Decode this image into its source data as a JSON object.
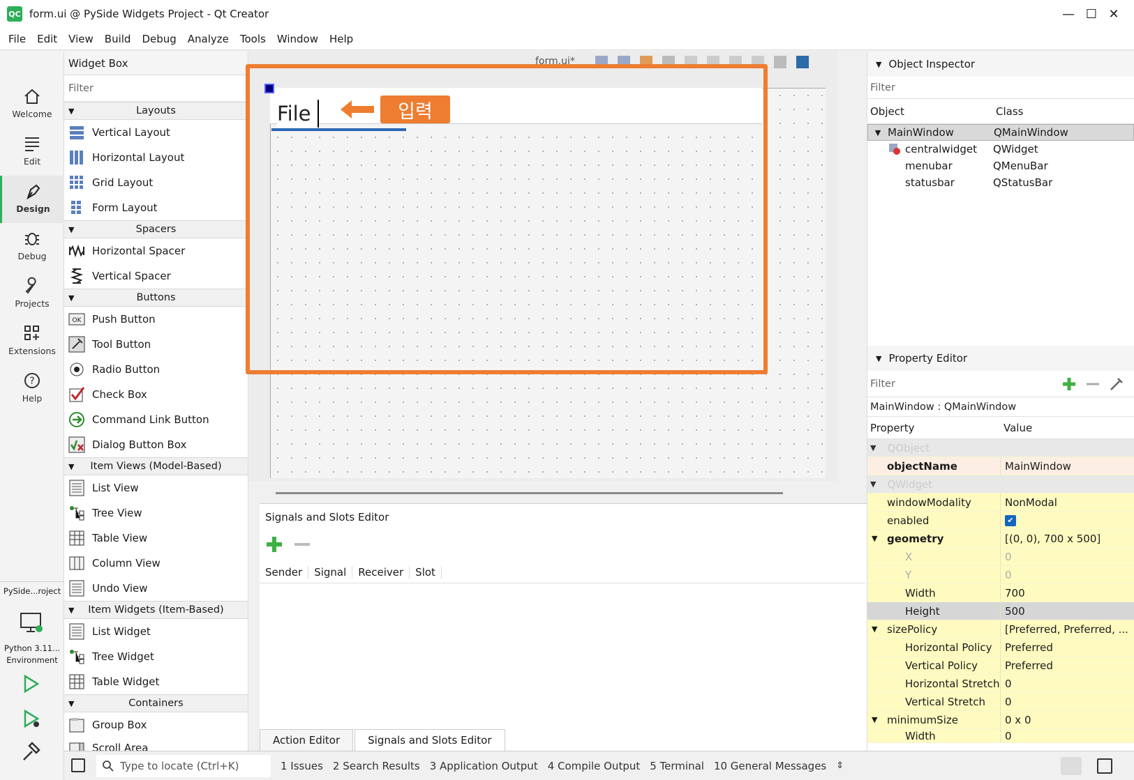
{
  "window": {
    "logo": "QC",
    "title": "form.ui @ PySide Widgets Project - Qt Creator",
    "minimize": "—",
    "maximize": "☐",
    "close": "✕"
  },
  "menubar": [
    "File",
    "Edit",
    "View",
    "Build",
    "Debug",
    "Analyze",
    "Tools",
    "Window",
    "Help"
  ],
  "modes": [
    {
      "label": "Welcome",
      "icon": "home-icon"
    },
    {
      "label": "Edit",
      "icon": "document-lines-icon"
    },
    {
      "label": "Design",
      "icon": "pen-icon"
    },
    {
      "label": "Debug",
      "icon": "bug-icon"
    },
    {
      "label": "Projects",
      "icon": "wrench-icon"
    },
    {
      "label": "Extensions",
      "icon": "grid-plus-icon"
    },
    {
      "label": "Help",
      "icon": "question-icon"
    }
  ],
  "kit": {
    "project": "PySide...roject",
    "env_line1": "Python 3.11...",
    "env_line2": "Environment"
  },
  "widget_box": {
    "title": "Widget Box",
    "filter_placeholder": "Filter",
    "categories": [
      {
        "label": "Layouts",
        "items": [
          "Vertical Layout",
          "Horizontal Layout",
          "Grid Layout",
          "Form Layout"
        ]
      },
      {
        "label": "Spacers",
        "items": [
          "Horizontal Spacer",
          "Vertical Spacer"
        ]
      },
      {
        "label": "Buttons",
        "items": [
          "Push Button",
          "Tool Button",
          "Radio Button",
          "Check Box",
          "Command Link Button",
          "Dialog Button Box"
        ]
      },
      {
        "label": "Item Views (Model-Based)",
        "items": [
          "List View",
          "Tree View",
          "Table View",
          "Column View",
          "Undo View"
        ]
      },
      {
        "label": "Item Widgets (Item-Based)",
        "items": [
          "List Widget",
          "Tree Widget",
          "Table Widget"
        ]
      },
      {
        "label": "Containers",
        "items": [
          "Group Box",
          "Scroll Area"
        ]
      }
    ]
  },
  "form": {
    "tab_label": "form.ui*",
    "menu_input_value": "File",
    "callout_label": "입력"
  },
  "signals_editor": {
    "title": "Signals and Slots Editor",
    "columns": [
      "Sender",
      "Signal",
      "Receiver",
      "Slot"
    ],
    "tabs": [
      "Action Editor",
      "Signals and Slots Editor"
    ]
  },
  "object_inspector": {
    "title": "Object Inspector",
    "filter_placeholder": "Filter",
    "col_object": "Object",
    "col_class": "Class",
    "rows": [
      {
        "object": "MainWindow",
        "class": "QMainWindow"
      },
      {
        "object": "centralwidget",
        "class": "QWidget"
      },
      {
        "object": "menubar",
        "class": "QMenuBar"
      },
      {
        "object": "statusbar",
        "class": "QStatusBar"
      }
    ]
  },
  "property_editor": {
    "title": "Property Editor",
    "filter_placeholder": "Filter",
    "context": "MainWindow : QMainWindow",
    "col_property": "Property",
    "col_value": "Value",
    "group_qobject": "QObject",
    "group_qwidget": "QWidget",
    "props": {
      "objectName": {
        "name": "objectName",
        "value": "MainWindow"
      },
      "windowModality": {
        "name": "windowModality",
        "value": "NonModal"
      },
      "enabled": {
        "name": "enabled",
        "value": "✔"
      },
      "geometry": {
        "name": "geometry",
        "value": "[(0, 0), 700 x 500]"
      },
      "x": {
        "name": "X",
        "value": "0"
      },
      "y": {
        "name": "Y",
        "value": "0"
      },
      "width": {
        "name": "Width",
        "value": "700"
      },
      "height": {
        "name": "Height",
        "value": "500"
      },
      "sizePolicy": {
        "name": "sizePolicy",
        "value": "[Preferred, Preferred, ..."
      },
      "hpolicy": {
        "name": "Horizontal Policy",
        "value": "Preferred"
      },
      "vpolicy": {
        "name": "Vertical Policy",
        "value": "Preferred"
      },
      "hstretch": {
        "name": "Horizontal Stretch",
        "value": "0"
      },
      "vstretch": {
        "name": "Vertical Stretch",
        "value": "0"
      },
      "minimumSize": {
        "name": "minimumSize",
        "value": "0 x 0"
      },
      "minwidth": {
        "name": "Width",
        "value": "0"
      }
    }
  },
  "statusbar": {
    "locator_placeholder": "Type to locate (Ctrl+K)",
    "panes": [
      "1  Issues",
      "2  Search Results",
      "3  Application Output",
      "4  Compile Output",
      "5  Terminal",
      "10  General Messages"
    ]
  },
  "colors": {
    "accent": "#ee7d31",
    "qt_green": "#2eae59",
    "selection_blue": "#2b68b8",
    "property_yellow": "#fffbc0"
  }
}
